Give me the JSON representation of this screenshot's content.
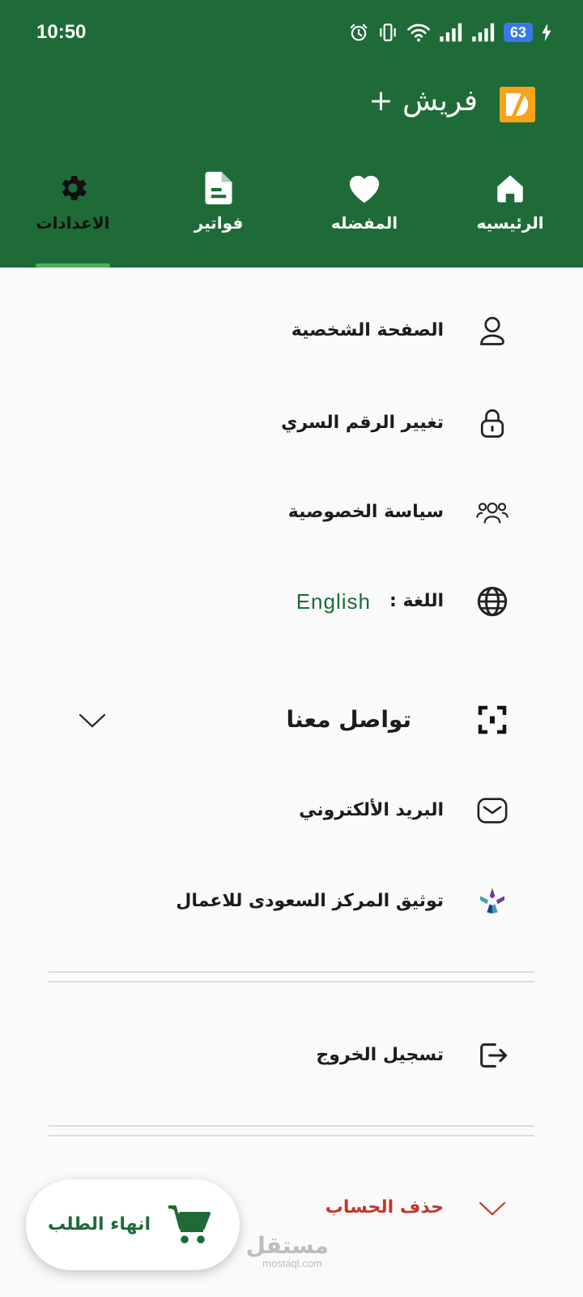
{
  "status_bar": {
    "time": "10:50",
    "battery": "63"
  },
  "app": {
    "title": "فريش +"
  },
  "tabs": [
    {
      "label": "الرئيسيه",
      "icon": "home-icon"
    },
    {
      "label": "المفضله",
      "icon": "heart-icon"
    },
    {
      "label": "فواتير",
      "icon": "document-icon"
    },
    {
      "label": "الاعدادات",
      "icon": "gear-icon",
      "active": true
    }
  ],
  "settings": {
    "profile": "الصفحة الشخصية",
    "change_password": "تغيير الرقم السري",
    "privacy_policy": "سياسة الخصوصية",
    "language_label": "اللغة :",
    "language_value": "English",
    "contact_us": "تواصل معنا",
    "email": "البريد الألكتروني",
    "saudi_center": "توثيق المركز السعودى للاعمال",
    "logout": "تسجيل الخروج",
    "delete_account": "حذف الحساب"
  },
  "fab": {
    "label": "انهاء الطلب",
    "icon": "cart-icon"
  },
  "watermark": {
    "arabic": "مستقل",
    "latin": "mostaql.com"
  },
  "colors": {
    "primary": "#1e6b37",
    "danger": "#c0392b",
    "accent": "#4cae5b"
  }
}
